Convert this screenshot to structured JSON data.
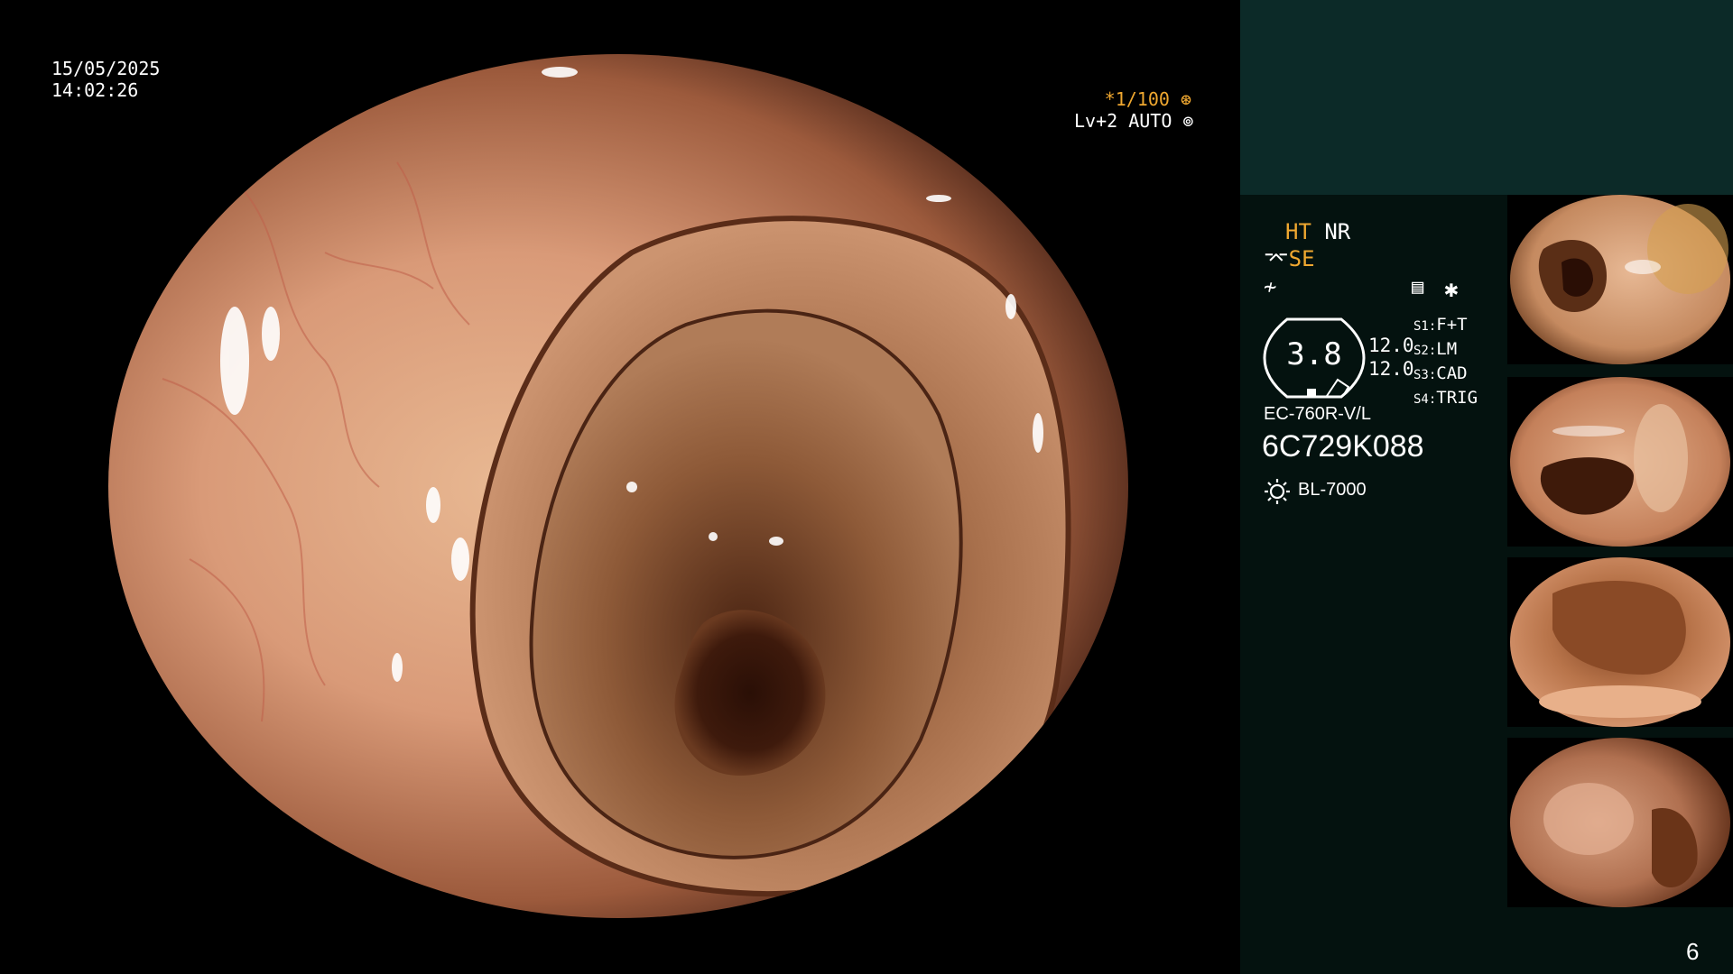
{
  "datetime": {
    "date": "15/05/2025",
    "time": "14:02:26"
  },
  "shutter": {
    "speed": "*1/100",
    "level": "Lv+2 AUTO"
  },
  "panel": {
    "ht": "HT",
    "nr": "NR",
    "se": "SE",
    "gauge_value": "3.8",
    "lens_values": [
      "12.0",
      "12.0"
    ],
    "switches": [
      {
        "key": "S1:",
        "value": "F+T"
      },
      {
        "key": "S2:",
        "value": "LM"
      },
      {
        "key": "S3:",
        "value": "CAD"
      },
      {
        "key": "S4:",
        "value": "TRIG"
      }
    ],
    "scope_model": "EC-760R-V/L",
    "scope_serial": "6C729K088",
    "light_source": "BL-7000"
  },
  "thumbnails": [
    {
      "name": "capture-1"
    },
    {
      "name": "capture-2"
    },
    {
      "name": "capture-3"
    },
    {
      "name": "capture-4"
    }
  ],
  "page_number": "6",
  "colors": {
    "orange": "#f0a830",
    "panel_top": "#0c2a28",
    "panel_bg": "#04120f"
  }
}
